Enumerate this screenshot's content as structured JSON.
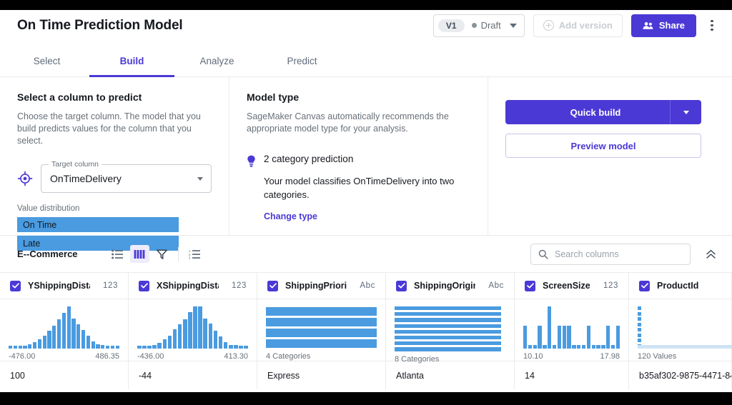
{
  "header": {
    "title": "On Time Prediction Model",
    "version_badge": "V1",
    "status": "Draft",
    "add_version_label": "Add version",
    "share_label": "Share",
    "icons": {
      "plus": "plus-circle-icon",
      "share": "people-icon",
      "menu": "kebab-menu-icon"
    }
  },
  "tabs": [
    {
      "label": "Select",
      "active": false
    },
    {
      "label": "Build",
      "active": true
    },
    {
      "label": "Analyze",
      "active": false
    },
    {
      "label": "Predict",
      "active": false
    }
  ],
  "select_column_panel": {
    "heading": "Select a column to predict",
    "description": "Choose the target column. The model that you build predicts values for the column that you select.",
    "field_legend": "Target column",
    "field_value": "OnTimeDelivery",
    "value_distribution_label": "Value distribution",
    "distribution": [
      {
        "label": "On Time",
        "width_pct": 100
      },
      {
        "label": "Late",
        "width_pct": 100
      }
    ]
  },
  "model_type_panel": {
    "heading": "Model type",
    "description": "SageMaker Canvas automatically recommends the appropriate model type for your analysis.",
    "type_title": "2 category prediction",
    "type_desc": "Your model classifies OnTimeDelivery into two categories.",
    "change_link": "Change type"
  },
  "actions": {
    "quick_build": "Quick build",
    "preview_model": "Preview model"
  },
  "dataset": {
    "name": "E--Commerce",
    "view_icons": [
      "list-view-icon",
      "column-view-icon",
      "filter-icon",
      "ordered-list-icon"
    ],
    "active_view": "column-view-icon",
    "search_placeholder": "Search columns",
    "search_value": "",
    "collapse_icon": "chevron-double-up-icon"
  },
  "columns": [
    {
      "name": "YShippingDistance",
      "type": "123",
      "checked": true,
      "viz": "histogram",
      "min": "-476.00",
      "max": "486.35",
      "bars": [
        7,
        6,
        6,
        7,
        10,
        15,
        22,
        31,
        42,
        55,
        70,
        85,
        100,
        72,
        58,
        44,
        30,
        17,
        10,
        8,
        7,
        7,
        7
      ],
      "cell": "100"
    },
    {
      "name": "XShippingDistance",
      "type": "123",
      "checked": true,
      "viz": "histogram",
      "min": "-436.00",
      "max": "413.30",
      "bars": [
        7,
        6,
        7,
        9,
        14,
        22,
        31,
        45,
        58,
        70,
        86,
        100,
        100,
        72,
        60,
        42,
        28,
        16,
        9,
        8,
        7,
        7
      ],
      "cell": "-44"
    },
    {
      "name": "ShippingPriority",
      "type": "Abc",
      "checked": true,
      "viz": "categories",
      "summary": "4 Categories",
      "cat_count": 4,
      "cell": "Express"
    },
    {
      "name": "ShippingOrigin",
      "type": "Abc",
      "checked": true,
      "viz": "categories",
      "summary": "8 Categories",
      "cat_count": 8,
      "cell": "Atlanta"
    },
    {
      "name": "ScreenSize",
      "type": "123",
      "checked": true,
      "viz": "histogram",
      "min": "10.10",
      "max": "17.98",
      "bars": [
        55,
        9,
        9,
        55,
        9,
        100,
        9,
        55,
        55,
        55,
        9,
        9,
        9,
        55,
        9,
        9,
        9,
        55,
        9,
        55
      ],
      "cell": "14"
    },
    {
      "name": "ProductId",
      "type": "",
      "checked": true,
      "viz": "identifier",
      "summary": "120 Values",
      "cell": "b35af302-9875-4471-84"
    }
  ],
  "colors": {
    "accent": "#4b39d6",
    "chart_blue": "#4a9be0",
    "text": "#16191f",
    "muted": "#687078"
  }
}
